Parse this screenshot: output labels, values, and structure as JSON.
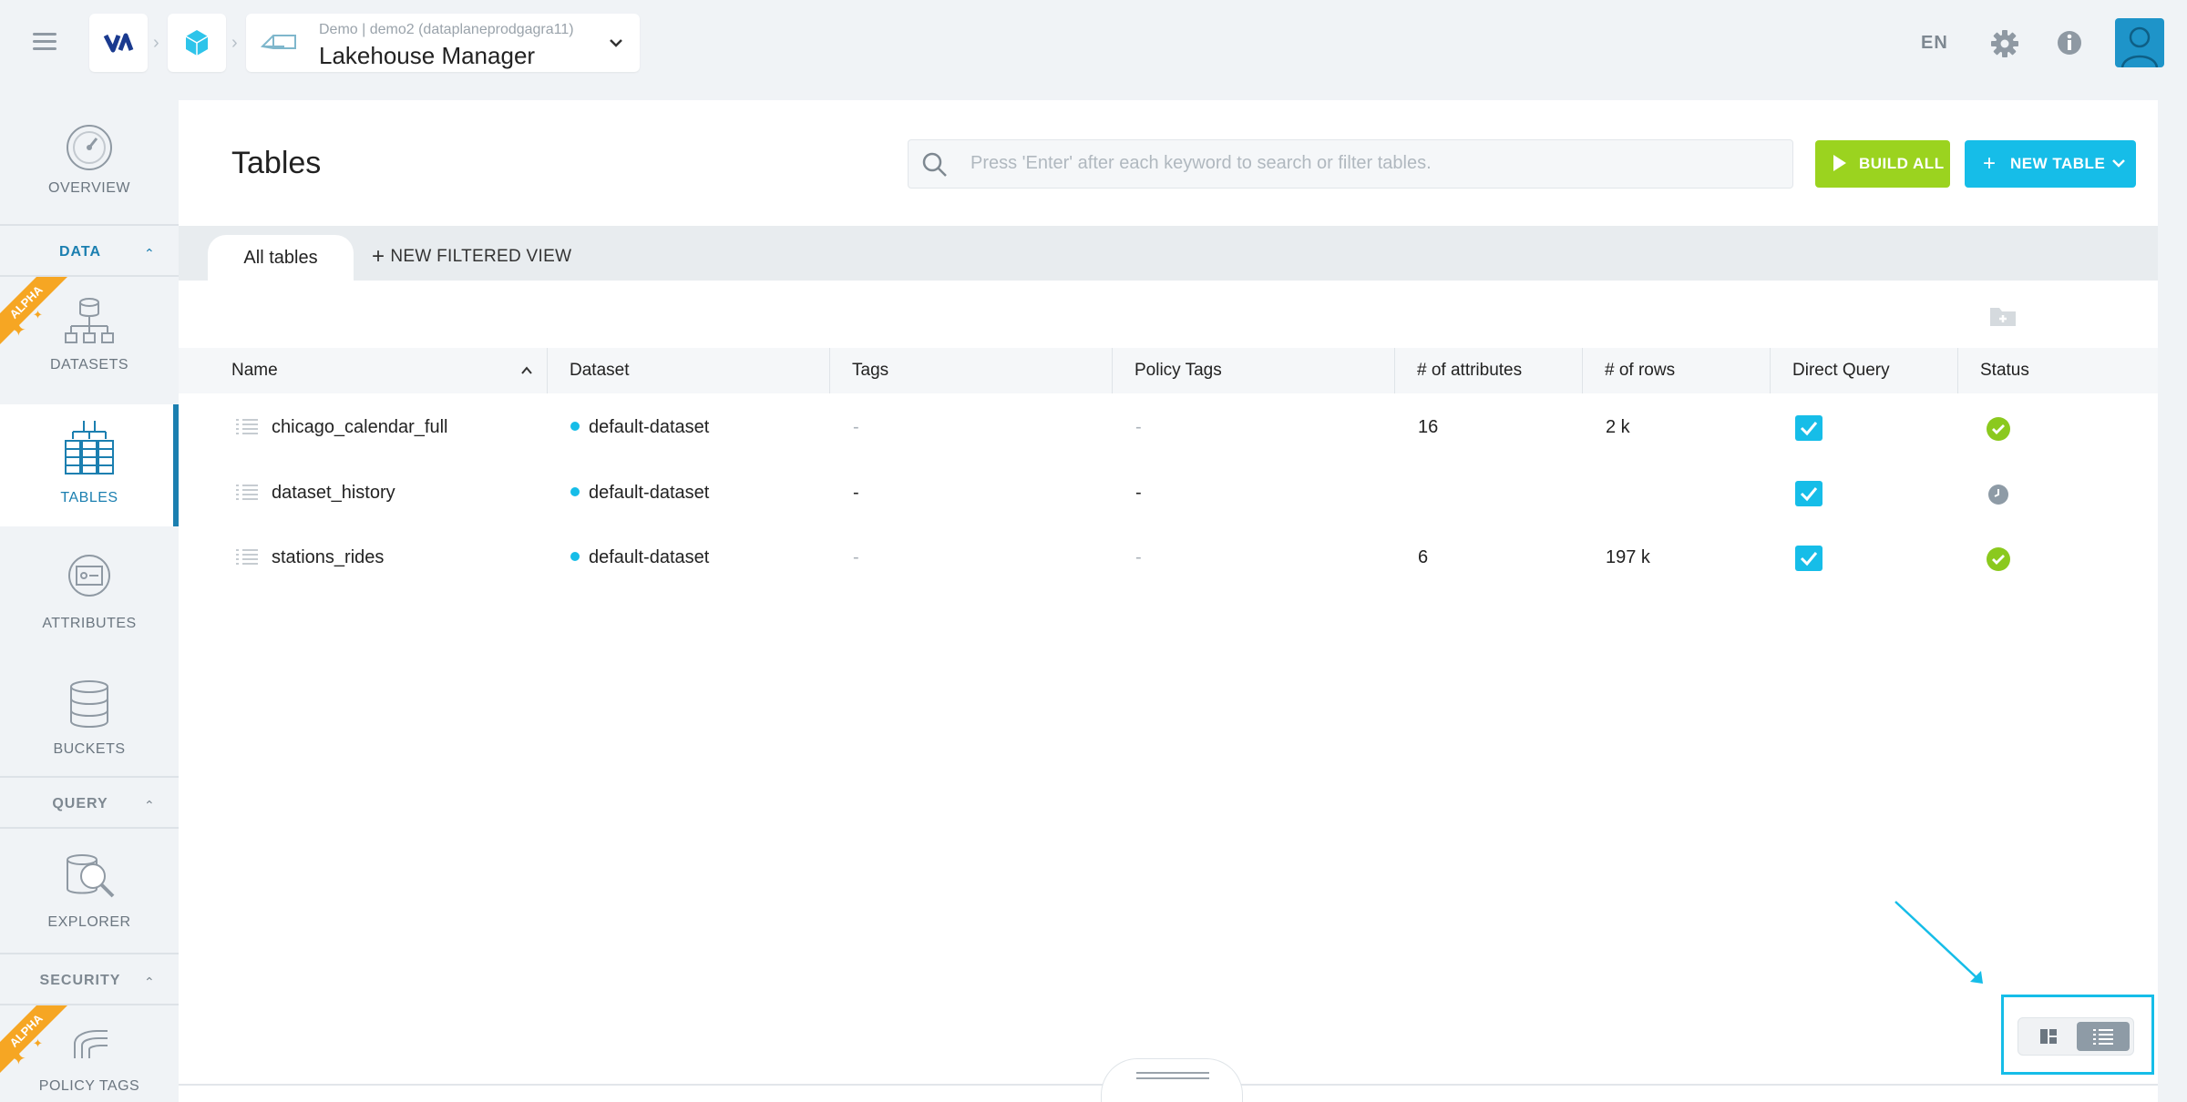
{
  "header": {
    "breadcrumb_sub": "Demo | demo2 (dataplaneprodgagra11)",
    "breadcrumb_title": "Lakehouse Manager",
    "language": "EN"
  },
  "sidebar": {
    "overview": "OVERVIEW",
    "data_section": "DATA",
    "datasets": "DATASETS",
    "tables": "TABLES",
    "attributes": "ATTRIBUTES",
    "buckets": "BUCKETS",
    "query_section": "QUERY",
    "explorer": "EXPLORER",
    "security_section": "SECURITY",
    "policy_tags": "POLICY TAGS",
    "alpha_badge": "ALPHA"
  },
  "main": {
    "title": "Tables",
    "search_placeholder": "Press 'Enter' after each keyword to search or filter tables.",
    "build_all_label": "BUILD ALL",
    "new_table_label": "NEW TABLE",
    "tabs": {
      "all_tables": "All tables",
      "new_filtered_view": "NEW FILTERED VIEW"
    }
  },
  "table": {
    "columns": [
      "Name",
      "Dataset",
      "Tags",
      "Policy Tags",
      "# of attributes",
      "# of rows",
      "Direct Query",
      "Status"
    ],
    "rows": [
      {
        "name": "chicago_calendar_full",
        "dataset": "default-dataset",
        "tags": "-",
        "policy_tags": "-",
        "attributes": "16",
        "rows": "2 k",
        "direct_query": true,
        "status": "success"
      },
      {
        "name": "dataset_history",
        "dataset": "default-dataset",
        "tags": "-",
        "policy_tags": "-",
        "attributes": "",
        "rows": "",
        "direct_query": true,
        "status": "pending"
      },
      {
        "name": "stations_rides",
        "dataset": "default-dataset",
        "tags": "-",
        "policy_tags": "-",
        "attributes": "6",
        "rows": "197 k",
        "direct_query": true,
        "status": "success"
      }
    ]
  },
  "colors": {
    "accent": "#16bde8",
    "build": "#9bd31f",
    "success": "#8bc91e",
    "active_nav": "#1b7fb0",
    "alpha": "#f6a623"
  }
}
